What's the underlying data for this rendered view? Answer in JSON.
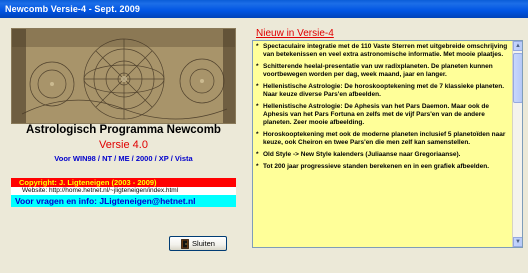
{
  "window": {
    "title": "Newcomb Versie-4 - Sept. 2009"
  },
  "left": {
    "app_title": "Astrologisch Programma Newcomb",
    "version": "Versie 4.0",
    "platforms": "Voor  WIN98 / NT / ME / 2000 / XP / Vista",
    "copyright": "Copyright:  J. Ligteneigen (2003 - 2009)",
    "website": "Website: http://home.hetnet.nl/~jligteneigen/index.html",
    "contact": "Voor vragen en info: JLigteneigen@hetnet.nl",
    "close_label": "Sluiten"
  },
  "right": {
    "news_title": "Nieuw in Versie-4",
    "items": [
      "Spectaculaire integratie met de 110 Vaste Sterren met uitgebreide omschrijving van betekenissen en veel extra astronomische informatie. Met mooie plaatjes.",
      "Schitterende heelal-presentatie van uw radixplaneten. De planeten kunnen voortbewegen worden per dag, week maand, jaar en langer.",
      "Hellenistische Astrologie: De horoskooptekening met de 7 klassieke planeten. Naar keuze diverse Pars'en afbeelden.",
      "Hellenistische Astrologie: De Aphesis van het Pars Daemon. Maar ook de Aphesis van het Pars Fortuna en zelfs met de vijf Pars'en van de andere planeten. Zeer mooie afbeelding.",
      "Horoskooptekening met ook de moderne planeten inclusief 5 planetoïden naar keuze, ook Cheiron en twee Pars'en die men zelf kan samenstellen.",
      "Old Style -> New Style kalenders (Juliaanse naar Gregoriaanse).",
      "Tot 200 jaar progressieve standen berekenen en in een grafiek afbeelden."
    ]
  },
  "colors": {
    "title_bar": "#0054E3",
    "version_red": "#E00000",
    "platform_blue": "#0000CC",
    "copyright_bg": "#FF0000",
    "contact_bg": "#00FFFF",
    "news_bg": "#FFFF99"
  },
  "icons": {
    "close": "door-exit-icon",
    "scroll_up": "arrow-up-icon",
    "scroll_down": "arrow-down-icon"
  }
}
